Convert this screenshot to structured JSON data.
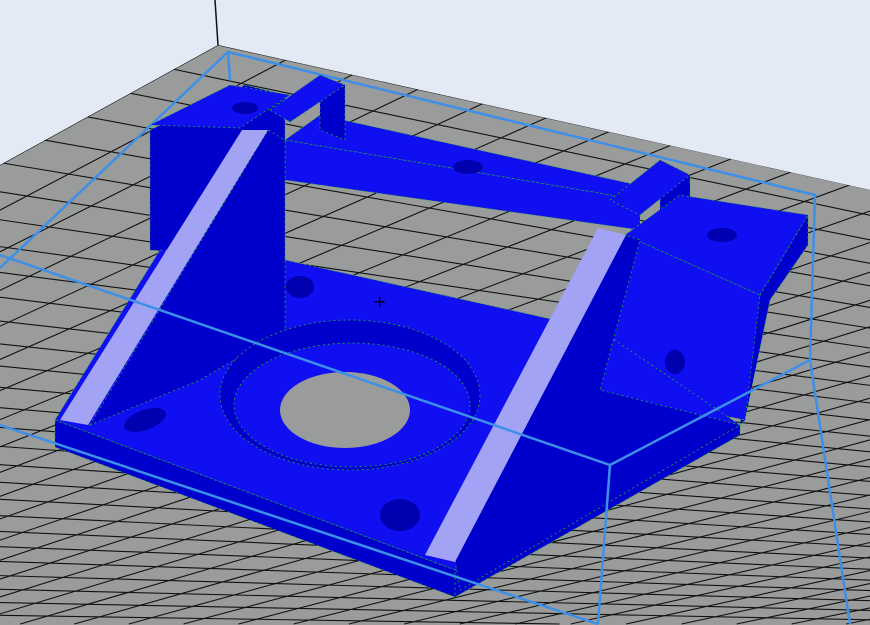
{
  "viewport": {
    "colors": {
      "background": "#e3e9f5",
      "bed": "#9a9c9c",
      "grid_line": "#111111",
      "bounding_box": "#3d8fe8",
      "object_top": "#0f0ff2",
      "object_side": "#0000cc",
      "object_highlight": "#a3a3f5",
      "hole": "#0000b0",
      "perimeter": "#22aa33"
    }
  }
}
